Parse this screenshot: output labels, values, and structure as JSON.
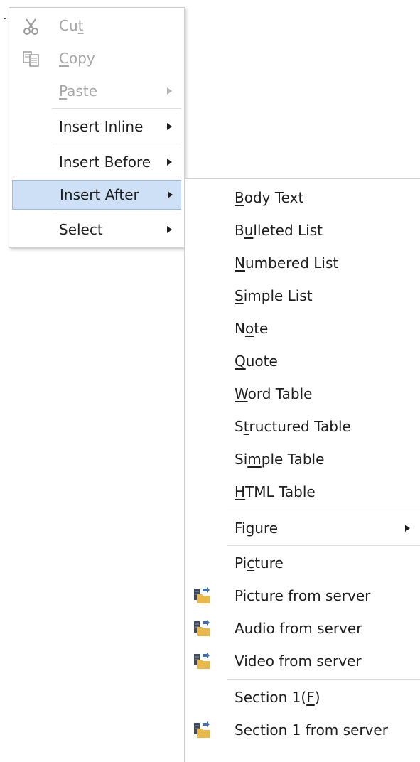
{
  "main_menu": {
    "cut": {
      "before": "Cu",
      "accel": "t",
      "after": ""
    },
    "copy": {
      "before": "",
      "accel": "C",
      "after": "opy"
    },
    "paste": {
      "before": "",
      "accel": "P",
      "after": "aste"
    },
    "insert_inline": {
      "label": "Insert Inline"
    },
    "insert_before": {
      "label": "Insert Before"
    },
    "insert_after": {
      "label": "Insert After"
    },
    "select": {
      "label": "Select"
    }
  },
  "submenu": {
    "body_text": {
      "before": "",
      "accel": "B",
      "after": "ody Text"
    },
    "bulleted_list": {
      "before": "B",
      "accel": "u",
      "after": "lleted List"
    },
    "numbered_list": {
      "before": "",
      "accel": "N",
      "after": "umbered List"
    },
    "simple_list": {
      "before": "",
      "accel": "S",
      "after": "imple List"
    },
    "note": {
      "before": "N",
      "accel": "o",
      "after": "te"
    },
    "quote": {
      "before": "",
      "accel": "Q",
      "after": "uote"
    },
    "word_table": {
      "before": "",
      "accel": "W",
      "after": "ord Table"
    },
    "structured_table": {
      "before": "S",
      "accel": "t",
      "after": "ructured Table"
    },
    "simple_table": {
      "before": "Si",
      "accel": "m",
      "after": "ple Table"
    },
    "html_table": {
      "before": "",
      "accel": "H",
      "after": "TML Table"
    },
    "figure": {
      "label": "Figure"
    },
    "picture": {
      "before": "Pi",
      "accel": "c",
      "after": "ture"
    },
    "picture_from_server": {
      "label": "Picture from server"
    },
    "audio_from_server": {
      "label": "Audio from server"
    },
    "video_from_server": {
      "label": "Video from server"
    },
    "section_1": {
      "before": "Section 1(",
      "accel": "F",
      "after": ")"
    },
    "section_1_from_server": {
      "label": "Section 1 from server"
    }
  },
  "icons": {
    "cut": "scissors-icon",
    "copy": "copy-icon",
    "server": "server-folder-icon"
  },
  "colors": {
    "selected_background": "#cde0f5",
    "selected_border": "#9bbbe3",
    "disabled_text": "#a7a7a7",
    "folder": "#e8b84a",
    "server": "#3f4a5c"
  }
}
